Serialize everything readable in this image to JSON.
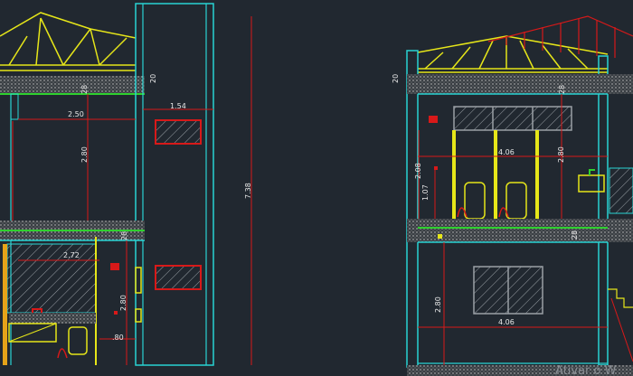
{
  "app": {
    "window": "CAD drawing viewport - sections"
  },
  "colors": {
    "background": "#212830",
    "structure": "#29d3d3",
    "slab": "#2fd02f",
    "roof": "#e6e619",
    "dimension": "#d81919",
    "text": "#e8e8e8",
    "hatch": "#9aa0a6",
    "concrete": "#3a3f44"
  },
  "left_section": {
    "dims": {
      "d_2_50": "2.50",
      "d_2_80_upper": "2.80",
      "d_1_54": "1.54",
      "d_2_72": "2.72",
      "d_2_80_lower": "2.80",
      "d_80": ".80",
      "d_28_top": "28",
      "d_28_mid": "28",
      "d_20": "20"
    }
  },
  "middle": {
    "total_height": "7.38"
  },
  "right_section": {
    "dims": {
      "d_20": "20",
      "d_28_top": "28",
      "d_28_mid": "28",
      "d_4_06_upper": "4.06",
      "d_2_80_upper": "2.80",
      "d_2_08": "2.08",
      "d_1_07": "1.07",
      "d_2_80_lower": "2.80",
      "d_4_06_lower": "4.06"
    }
  },
  "watermark": "Ativar o W"
}
